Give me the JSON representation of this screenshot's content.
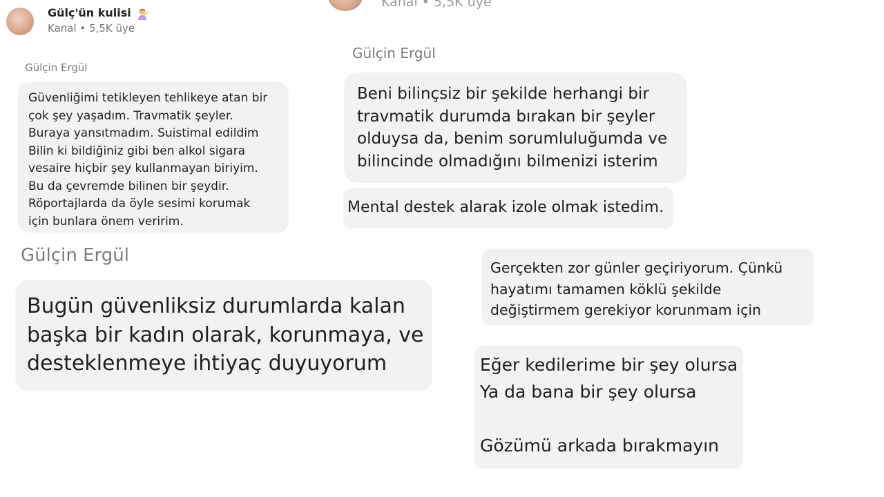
{
  "header_left": {
    "channel_name": "Gülç'ün kulisi",
    "channel_meta": "Kanal • 5,5K üye"
  },
  "header_top_cut": {
    "channel_meta": "Kanal • 5,5K üye"
  },
  "messages": [
    {
      "sender": "Gülçin Ergül",
      "lines": [
        "Güvenliğimi tetikleyen tehlikeye atan bir",
        "çok şey yaşadım. Travmatik şeyler.",
        "Buraya yansıtmadım. Suistimal edildim",
        "Bilin ki bildiğiniz gibi ben alkol sigara",
        "vesaire hiçbir şey kullanmayan biriyim.",
        "Bu da çevremde bilinen bir şeydir.",
        "Röportajlarda da öyle sesimi korumak",
        "için bunlara önem veririm."
      ]
    },
    {
      "sender": "Gülçin Ergül",
      "lines": [
        "Beni bilinçsiz bir şekilde herhangi bir",
        "travmatik durumda bırakan bir şeyler",
        "olduysa da, benim sorumluluğumda ve",
        "bilincinde olmadığını bilmenizi isterim"
      ]
    },
    {
      "lines": [
        "Mental destek alarak izole olmak istedim."
      ]
    },
    {
      "sender": "Gülçin Ergül",
      "lines": [
        "Bugün güvenliksiz durumlarda kalan",
        "başka bir kadın olarak, korunmaya, ve",
        "desteklenmeye ihtiyaç duyuyorum"
      ]
    },
    {
      "lines": [
        "Gerçekten zor günler geçiriyorum. Çünkü",
        "hayatımı tamamen köklü şekilde",
        "değiştirmem gerekiyor korunmam için"
      ]
    },
    {
      "lines": [
        "Eğer kedilerime bir şey olursa",
        "Ya da bana bir şey olursa",
        "",
        "Gözümü arkada bırakmayın"
      ]
    }
  ]
}
